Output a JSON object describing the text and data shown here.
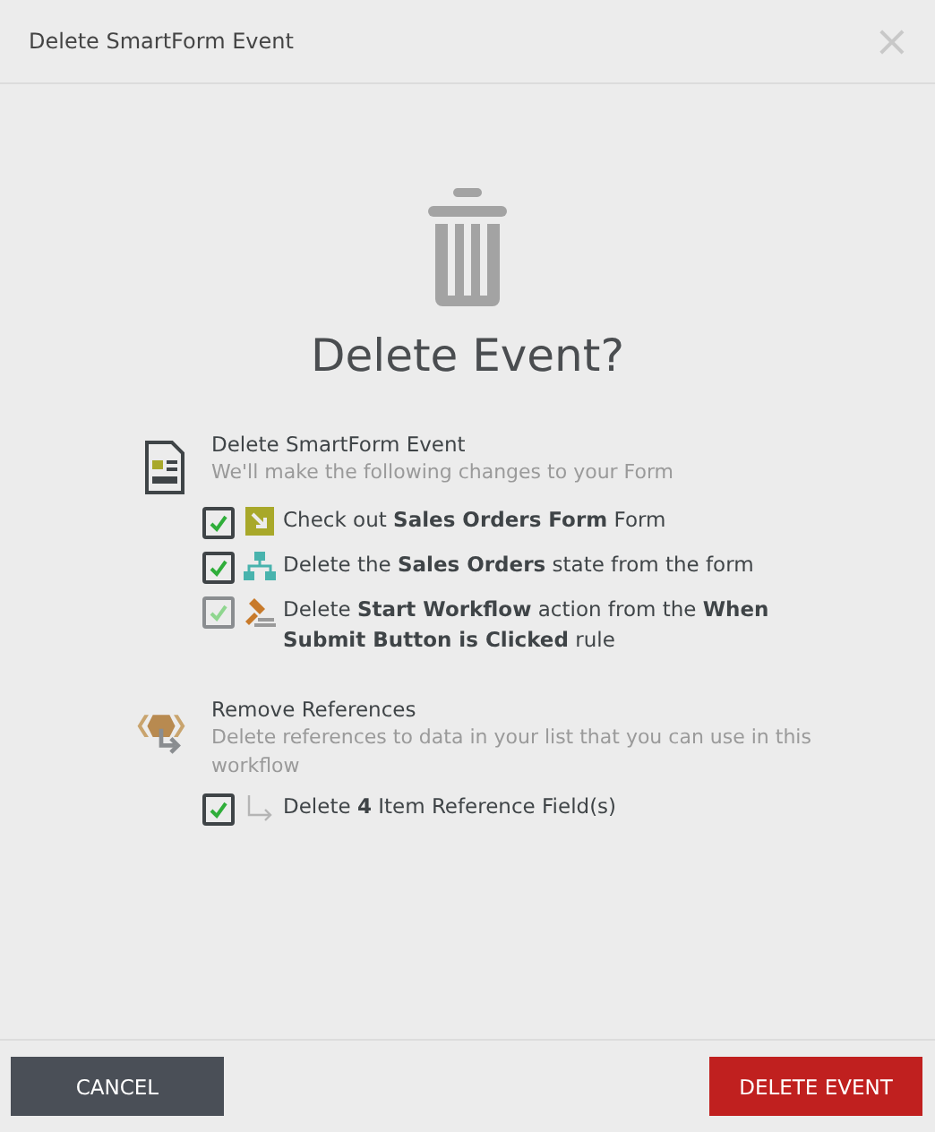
{
  "dialog": {
    "title": "Delete SmartForm Event",
    "close": "×"
  },
  "heading": "Delete Event?",
  "sections": [
    {
      "kind": "form",
      "title": "Delete SmartForm Event",
      "description": "We'll make the following changes to your Form",
      "items": [
        {
          "kind": "checkout",
          "text": "Check out **Sales Orders Form** Form",
          "checked": true,
          "disabled": false
        },
        {
          "kind": "state",
          "text": "Delete the **Sales Orders** state from the form",
          "checked": true,
          "disabled": false
        },
        {
          "kind": "action",
          "text": "Delete **Start Workflow** action from the **When Submit Button is Clicked** rule",
          "checked": true,
          "disabled": true
        }
      ]
    },
    {
      "kind": "references",
      "title": "Remove References",
      "description": "Delete references to data in your list that you can use in this workflow",
      "items": [
        {
          "kind": "reference",
          "text": "Delete **4** Item Reference Field(s)",
          "checked": true,
          "disabled": false
        }
      ]
    }
  ],
  "buttons": [
    {
      "kind": "secondary",
      "label": "CANCEL"
    },
    {
      "kind": "danger",
      "label": "DELETE EVENT"
    }
  ]
}
